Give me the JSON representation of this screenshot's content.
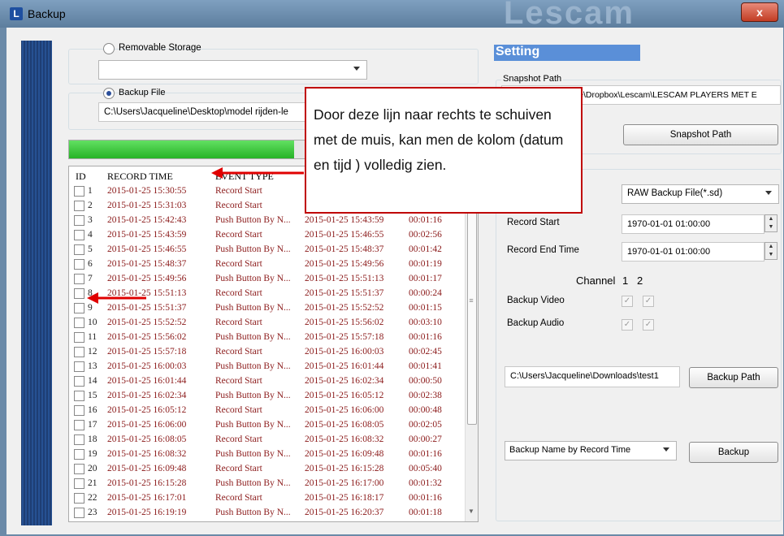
{
  "window": {
    "title": "Backup",
    "close": "x",
    "brand": "Lescam",
    "app_icon": "L"
  },
  "storage": {
    "removable_label": "Removable Storage",
    "removable_value": "",
    "backup_file_label": "Backup File",
    "backup_file_path": "C:\\Users\\Jacqueline\\Desktop\\model rijden-le",
    "progress": 0.55
  },
  "table": {
    "headers": [
      "ID",
      "RECORD TIME",
      "EVENT TYPE"
    ],
    "rows": [
      [
        "1",
        "2015-01-25 15:30:55",
        "Record Start",
        "",
        ""
      ],
      [
        "2",
        "2015-01-25 15:31:03",
        "Record Start",
        "",
        ""
      ],
      [
        "3",
        "2015-01-25 15:42:43",
        "Push Button By N...",
        "2015-01-25 15:43:59",
        "00:01:16"
      ],
      [
        "4",
        "2015-01-25 15:43:59",
        "Record Start",
        "2015-01-25 15:46:55",
        "00:02:56"
      ],
      [
        "5",
        "2015-01-25 15:46:55",
        "Push Button By N...",
        "2015-01-25 15:48:37",
        "00:01:42"
      ],
      [
        "6",
        "2015-01-25 15:48:37",
        "Record Start",
        "2015-01-25 15:49:56",
        "00:01:19"
      ],
      [
        "7",
        "2015-01-25 15:49:56",
        "Push Button By N...",
        "2015-01-25 15:51:13",
        "00:01:17"
      ],
      [
        "8",
        "2015-01-25 15:51:13",
        "Record Start",
        "2015-01-25 15:51:37",
        "00:00:24"
      ],
      [
        "9",
        "2015-01-25 15:51:37",
        "Push Button By N...",
        "2015-01-25 15:52:52",
        "00:01:15"
      ],
      [
        "10",
        "2015-01-25 15:52:52",
        "Record Start",
        "2015-01-25 15:56:02",
        "00:03:10"
      ],
      [
        "11",
        "2015-01-25 15:56:02",
        "Push Button By N...",
        "2015-01-25 15:57:18",
        "00:01:16"
      ],
      [
        "12",
        "2015-01-25 15:57:18",
        "Record Start",
        "2015-01-25 16:00:03",
        "00:02:45"
      ],
      [
        "13",
        "2015-01-25 16:00:03",
        "Push Button By N...",
        "2015-01-25 16:01:44",
        "00:01:41"
      ],
      [
        "14",
        "2015-01-25 16:01:44",
        "Record Start",
        "2015-01-25 16:02:34",
        "00:00:50"
      ],
      [
        "15",
        "2015-01-25 16:02:34",
        "Push Button By N...",
        "2015-01-25 16:05:12",
        "00:02:38"
      ],
      [
        "16",
        "2015-01-25 16:05:12",
        "Record Start",
        "2015-01-25 16:06:00",
        "00:00:48"
      ],
      [
        "17",
        "2015-01-25 16:06:00",
        "Push Button By N...",
        "2015-01-25 16:08:05",
        "00:02:05"
      ],
      [
        "18",
        "2015-01-25 16:08:05",
        "Record Start",
        "2015-01-25 16:08:32",
        "00:00:27"
      ],
      [
        "19",
        "2015-01-25 16:08:32",
        "Push Button By N...",
        "2015-01-25 16:09:48",
        "00:01:16"
      ],
      [
        "20",
        "2015-01-25 16:09:48",
        "Record Start",
        "2015-01-25 16:15:28",
        "00:05:40"
      ],
      [
        "21",
        "2015-01-25 16:15:28",
        "Push Button By N...",
        "2015-01-25 16:17:00",
        "00:01:32"
      ],
      [
        "22",
        "2015-01-25 16:17:01",
        "Record Start",
        "2015-01-25 16:18:17",
        "00:01:16"
      ],
      [
        "23",
        "2015-01-25 16:19:19",
        "Push Button By N...",
        "2015-01-25 16:20:37",
        "00:01:18"
      ]
    ]
  },
  "setting": {
    "title": "Setting",
    "snapshot_path_label": "Snapshot Path",
    "snapshot_path_value": "C:\\Users\\Jacqueline\\Dropbox\\Lescam\\LESCAM PLAYERS MET E",
    "snapshot_button": "Snapshot Path",
    "format_value": "RAW Backup File(*.sd)",
    "record_start_label": "Record Start",
    "record_start_value": "1970-01-01 01:00:00",
    "record_end_label": "Record End Time",
    "record_end_value": "1970-01-01 01:00:00",
    "channel_label": "Channel",
    "channel_1": "1",
    "channel_2": "2",
    "backup_video_label": "Backup Video",
    "backup_audio_label": "Backup Audio",
    "backup_path_value": "C:\\Users\\Jacqueline\\Downloads\\test1",
    "backup_path_button": "Backup Path",
    "name_mode_value": "Backup Name by Record Time",
    "backup_button": "Backup"
  },
  "callout": {
    "text": "Door deze lijn naar rechts te schuiven met de muis, kan men de kolom (datum en tijd ) volledig zien."
  },
  "colors": {
    "annotation": "#e00000",
    "row_text": "#8b1a1a",
    "progress": "#2ab82a",
    "setting_title_bg": "#5a8fd8"
  }
}
